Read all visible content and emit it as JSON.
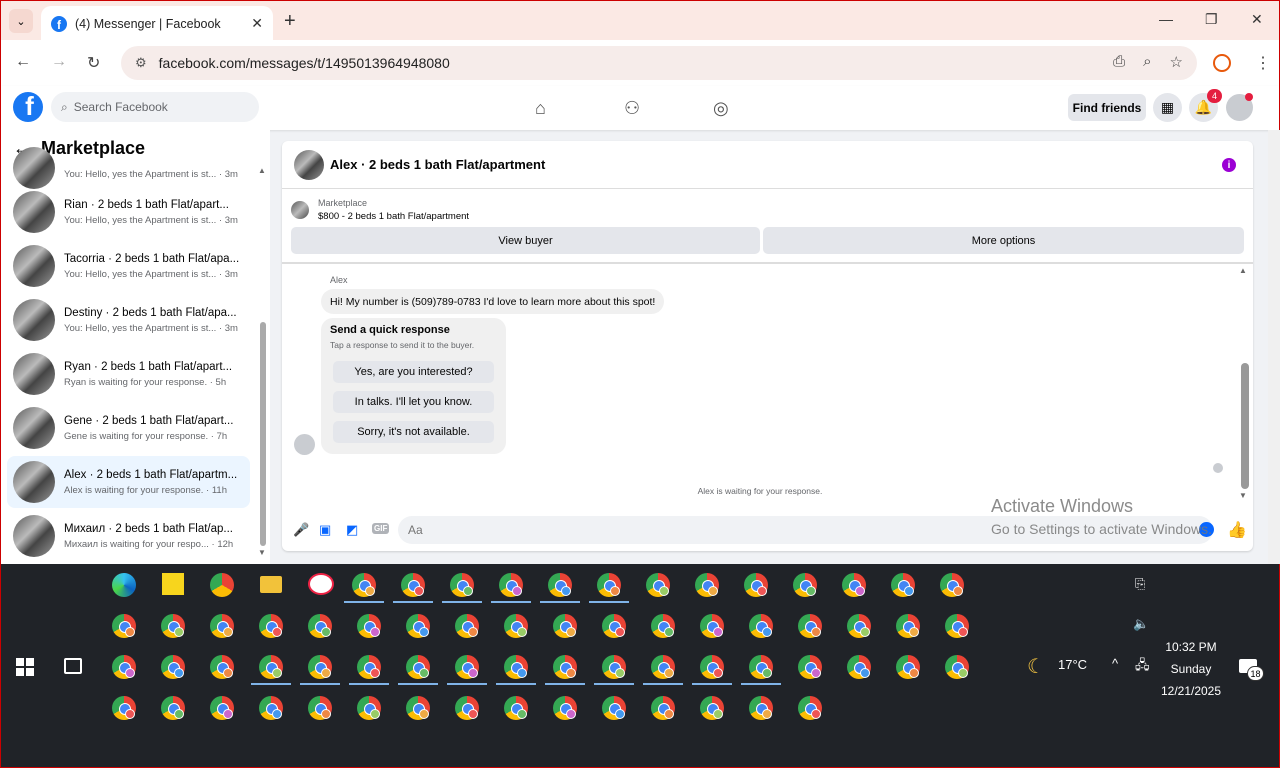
{
  "browser": {
    "tab_title": "(4) Messenger | Facebook",
    "url": "facebook.com/messages/t/1495013964948080"
  },
  "fb": {
    "search_placeholder": "Search Facebook",
    "find_friends": "Find friends",
    "notif_count": "4"
  },
  "sidebar": {
    "title": "Marketplace",
    "conversations": [
      {
        "name": "",
        "preview": "You: Hello, yes the Apartment is st... · 3m"
      },
      {
        "name": "Rian · 2 beds 1 bath Flat/apart...",
        "preview": "You: Hello, yes the Apartment is st... · 3m"
      },
      {
        "name": "Tacorria · 2 beds 1 bath Flat/apa...",
        "preview": "You: Hello, yes the Apartment is st... · 3m"
      },
      {
        "name": "Destiny · 2 beds 1 bath Flat/apa...",
        "preview": "You: Hello, yes the Apartment is st... · 3m"
      },
      {
        "name": "Ryan · 2 beds 1 bath Flat/apart...",
        "preview": "Ryan is waiting for your response. · 5h"
      },
      {
        "name": "Gene · 2 beds 1 bath Flat/apart...",
        "preview": "Gene is waiting for your response. · 7h"
      },
      {
        "name": "Alex · 2 beds 1 bath Flat/apartm...",
        "preview": "Alex is waiting for your response. · 11h"
      },
      {
        "name": "Михаил · 2 beds 1 bath Flat/ap...",
        "preview": "Михаил is waiting for your respo... · 12h"
      }
    ]
  },
  "chat": {
    "title": "Alex · 2 beds 1 bath Flat/apartment",
    "marketplace_label": "Marketplace",
    "listing": "$800 - 2 beds 1 bath Flat/apartment",
    "view_buyer": "View buyer",
    "more_options": "More options",
    "sender": "Alex",
    "message": "Hi! My number is (509)789-0783 I'd love to learn more about this spot!",
    "quick_title": "Send a quick response",
    "quick_sub": "Tap a response to send it to the buyer.",
    "quick_options": [
      "Yes, are you interested?",
      "In talks. I'll let you know.",
      "Sorry, it's not available."
    ],
    "waiting": "Alex is waiting for your response.",
    "input_placeholder": "Aa",
    "gif": "GIF"
  },
  "watermark": {
    "line1": "Activate Windows",
    "line2": "Go to Settings to activate Windows."
  },
  "taskbar": {
    "temp": "17°C",
    "time": "10:32 PM",
    "day": "Sunday",
    "date": "12/21/2025",
    "notif_count": "18"
  }
}
